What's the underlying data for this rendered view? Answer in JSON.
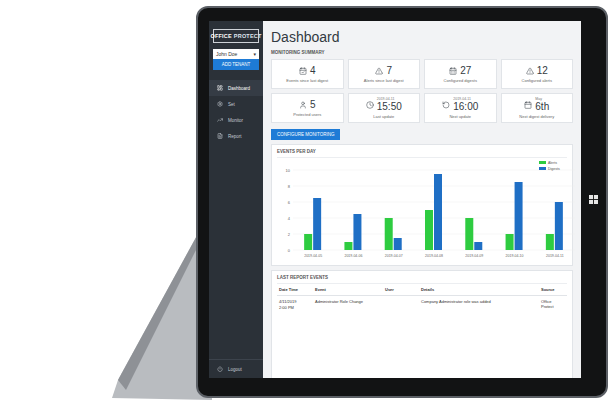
{
  "brand": {
    "first": "OFFICE",
    "second": "PROTECT"
  },
  "sidebar": {
    "tenant": "John Doe",
    "tenant_arrow": "▾",
    "add_button": "ADD TENANT",
    "items": [
      {
        "label": "Dashboard",
        "selected": true
      },
      {
        "label": "Set",
        "selected": false
      },
      {
        "label": "Monitor",
        "selected": false
      },
      {
        "label": "Report",
        "selected": false
      }
    ],
    "logout": "Logout"
  },
  "page_title": "Dashboard",
  "summary": {
    "title": "MONITORING SUMMARY",
    "cards": [
      {
        "value": "4",
        "caption": "Events since last digest",
        "note": ""
      },
      {
        "value": "7",
        "caption": "Alerts since last digest",
        "note": ""
      },
      {
        "value": "27",
        "caption": "Configured digests",
        "note": ""
      },
      {
        "value": "12",
        "caption": "Configured alerts",
        "note": ""
      },
      {
        "value": "5",
        "caption": "Protected users",
        "note": ""
      },
      {
        "value": "15:50",
        "caption": "Last update",
        "note": "2019-04-11"
      },
      {
        "value": "16:00",
        "caption": "Next update",
        "note": "2019-04-11"
      },
      {
        "value": "6th",
        "caption": "Next digest delivery",
        "note": "May"
      }
    ]
  },
  "configure_button": "CONFIGURE MONITORING",
  "chart": {
    "title": "EVENTS PER DAY",
    "y_ticks": [
      "0",
      "2",
      "4",
      "6",
      "8",
      "10"
    ],
    "y_max": 10,
    "x_labels": [
      "2019-04-05",
      "2019-04-06",
      "2019-04-07",
      "2019-04-08",
      "2019-04-09",
      "2019-04-10",
      "2019-04-11"
    ],
    "series": [
      {
        "name": "Alerts",
        "color": "#2ecc40",
        "values": [
          2,
          1,
          4,
          5,
          4,
          2,
          2
        ]
      },
      {
        "name": "Digests",
        "color": "#1f6fc5",
        "values": [
          6.5,
          4.5,
          1.5,
          9.5,
          1,
          8.5,
          6
        ]
      }
    ]
  },
  "table": {
    "title": "LAST REPORT EVENTS",
    "columns": [
      "Date Time",
      "Event",
      "User",
      "Details",
      "Source"
    ],
    "rows": [
      {
        "date": "4/11/2019",
        "time": "2:00 PM",
        "event": "Administrator Role Change",
        "user": "",
        "details": "Company Administrator role was added",
        "source": "Office Protect"
      }
    ]
  }
}
